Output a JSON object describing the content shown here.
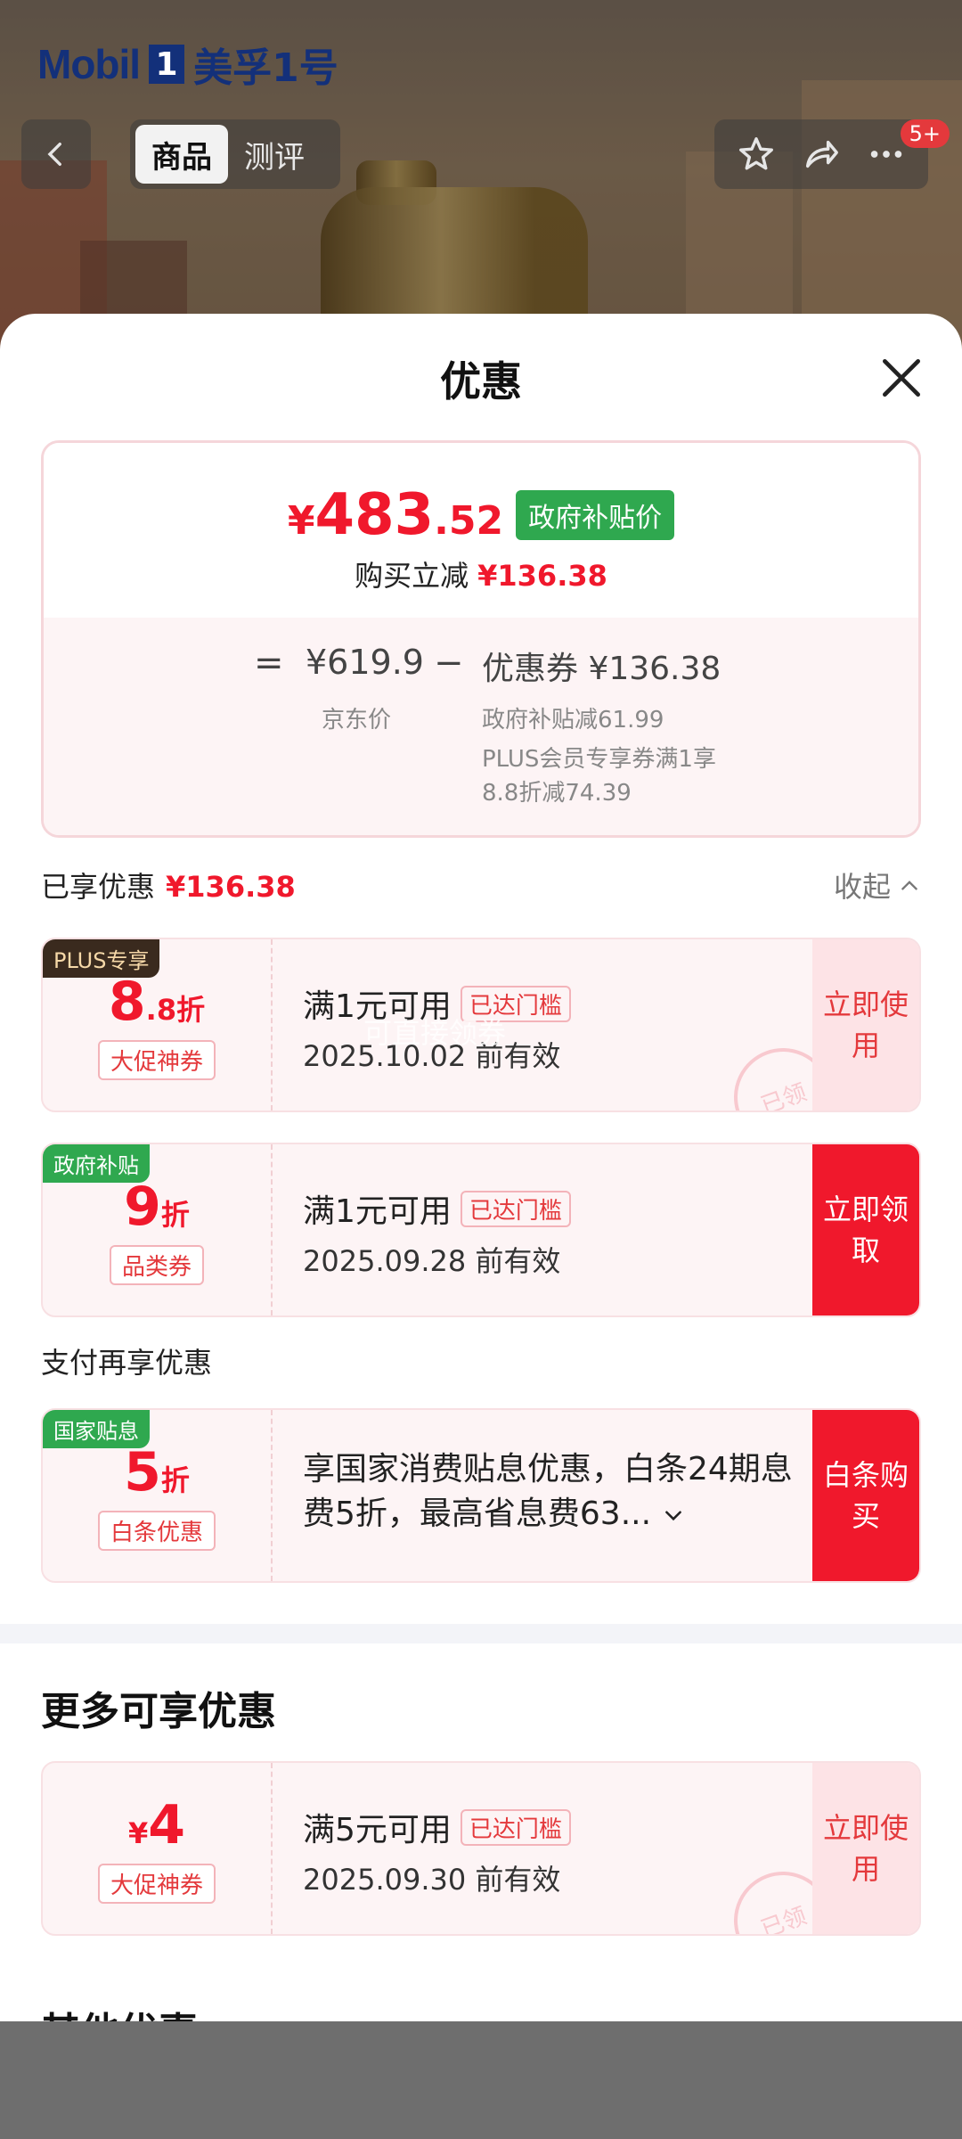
{
  "brand": {
    "name": "Mobil",
    "one": "1",
    "cn": "美孚1号"
  },
  "header": {
    "tabs": [
      {
        "label": "商品",
        "active": true
      },
      {
        "label": "测评",
        "active": false
      }
    ],
    "badge": "5+"
  },
  "sheet": {
    "title": "优惠",
    "price": {
      "yen": "¥",
      "integer": "483",
      "decimal": ".52",
      "tag": "政府补贴价",
      "reduce_label": "购买立减",
      "reduce_value": "¥136.38",
      "eq": "=",
      "jd_price": "¥619.9",
      "jd_label": "京东价",
      "minus": "−",
      "coupon_sum": "优惠券 ¥136.38",
      "break1": "政府补贴减61.99",
      "break2": "PLUS会员专享券满1享8.8折减74.39"
    },
    "enjoyed": {
      "label": "已享优惠",
      "value": "¥136.38",
      "collapse": "收起"
    },
    "coupons": [
      {
        "corner": "PLUS专享",
        "big": "8",
        "small": ".8折",
        "tag": "大促神券",
        "cond": "满1元可用",
        "met": "已达门槛",
        "valid": "2025.10.02 前有效",
        "action": "立即使用",
        "stamp": "已领",
        "watermark": "可直接领券"
      },
      {
        "corner": "政府补贴",
        "big": "9",
        "small": "折",
        "tag": "品类券",
        "cond": "满1元可用",
        "met": "已达门槛",
        "valid": "2025.09.28 前有效",
        "action": "立即领取"
      }
    ],
    "pay_section": "支付再享优惠",
    "pay_coupon": {
      "corner": "国家贴息",
      "big": "5",
      "small": "折",
      "tag": "白条优惠",
      "desc": "享国家消费贴息优惠，白条24期息费5折，最高省息费63...",
      "action": "白条购买"
    },
    "more_title": "更多可享优惠",
    "more_coupon": {
      "yen": "¥",
      "big": "4",
      "tag": "大促神券",
      "cond": "满5元可用",
      "met": "已达门槛",
      "valid": "2025.09.30 前有效",
      "action": "立即使用",
      "stamp": "已领"
    },
    "other_title": "其他优惠"
  }
}
